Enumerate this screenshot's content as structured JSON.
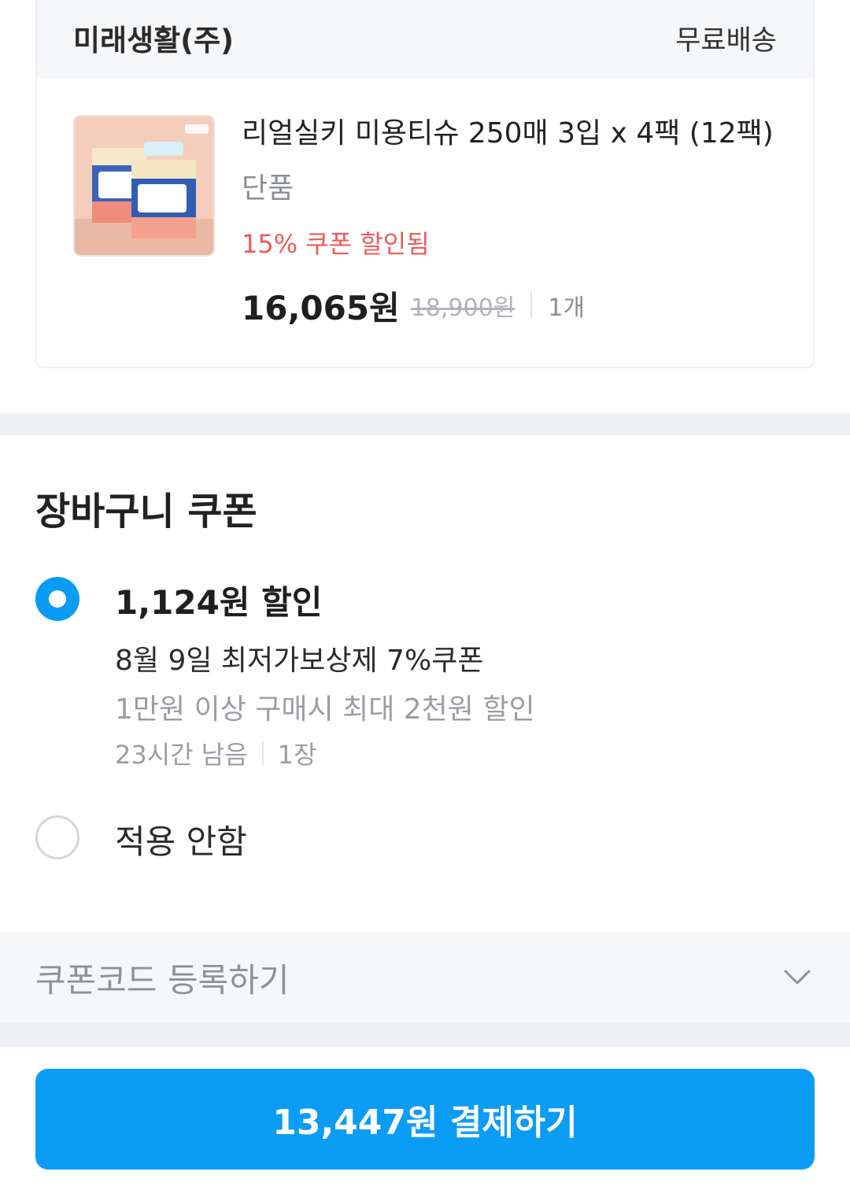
{
  "seller": {
    "name": "미래생활(주)",
    "shipping": "무료배송"
  },
  "product": {
    "name": "리얼실키 미용티슈 250매 3입 x 4팩 (12팩)",
    "option": "단품",
    "coupon_applied": "15% 쿠폰 할인됨",
    "price_final": "16,065원",
    "price_original": "18,900원",
    "quantity": "1개",
    "thumbnail_icon": "tissue-box-product-image"
  },
  "cart_coupon": {
    "title": "장바구니 쿠폰",
    "options": [
      {
        "amount": "1,124원 할인",
        "name": "8월 9일 최저가보상제 7%쿠폰",
        "condition": "1만원 이상 구매시 최대 2천원 할인",
        "time_left": "23시간 남음",
        "count": "1장",
        "selected": true
      },
      {
        "label": "적용 안함",
        "selected": false
      }
    ]
  },
  "coupon_code": {
    "label": "쿠폰코드 등록하기",
    "icon": "chevron-down-icon"
  },
  "pay_button": {
    "label": "13,447원 결제하기"
  },
  "colors": {
    "accent": "#0b9cf5",
    "discount_red": "#ef5a5a",
    "divider_gray": "#eef0f3"
  }
}
